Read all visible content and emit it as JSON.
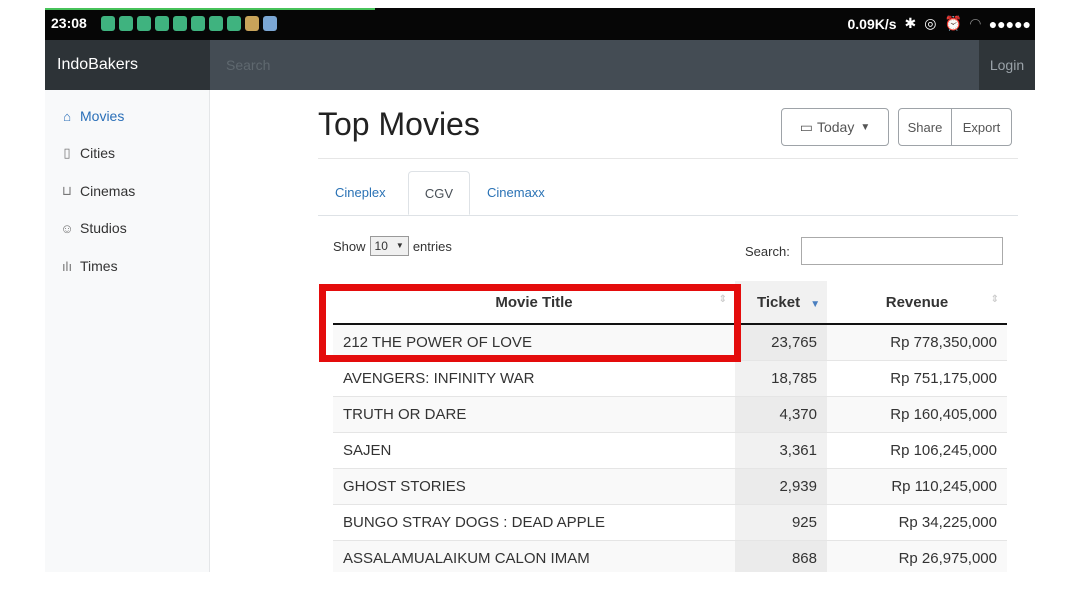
{
  "status_bar": {
    "time": "23:08",
    "net_speed": "0.09K/s",
    "icons": [
      "bluetooth-icon",
      "vpn-icon",
      "alarm-icon",
      "wifi-icon",
      "signal-icon"
    ],
    "signal_dots": "●●●●●"
  },
  "navbar": {
    "brand": "IndoBakers",
    "search_placeholder": "Search",
    "login": "Login"
  },
  "sidebar": {
    "items": [
      {
        "label": "Movies",
        "icon": "home-icon",
        "active": true
      },
      {
        "label": "Cities",
        "icon": "file-icon",
        "active": false
      },
      {
        "label": "Cinemas",
        "icon": "cart-icon",
        "active": false
      },
      {
        "label": "Studios",
        "icon": "users-icon",
        "active": false
      },
      {
        "label": "Times",
        "icon": "bar-chart-icon",
        "active": false
      }
    ]
  },
  "main": {
    "title": "Top Movies",
    "date_button": "Today",
    "share": "Share",
    "export": "Export",
    "tabs": [
      {
        "label": "Cineplex",
        "active": false
      },
      {
        "label": "CGV",
        "active": true
      },
      {
        "label": "Cinemaxx",
        "active": false
      }
    ],
    "show_label": "Show",
    "entries_value": "10",
    "entries_label": "entries",
    "search_label": "Search:"
  },
  "table": {
    "columns": [
      "Movie Title",
      "Ticket",
      "Revenue"
    ],
    "rows": [
      {
        "title": "212 THE POWER OF LOVE",
        "ticket": "23,765",
        "revenue": "Rp 778,350,000"
      },
      {
        "title": "AVENGERS: INFINITY WAR",
        "ticket": "18,785",
        "revenue": "Rp 751,175,000"
      },
      {
        "title": "TRUTH OR DARE",
        "ticket": "4,370",
        "revenue": "Rp 160,405,000"
      },
      {
        "title": "SAJEN",
        "ticket": "3,361",
        "revenue": "Rp 106,245,000"
      },
      {
        "title": "GHOST STORIES",
        "ticket": "2,939",
        "revenue": "Rp 110,245,000"
      },
      {
        "title": "BUNGO STRAY DOGS : DEAD APPLE",
        "ticket": "925",
        "revenue": "Rp 34,225,000"
      },
      {
        "title": "ASSALAMUALAIKUM CALON IMAM",
        "ticket": "868",
        "revenue": "Rp 26,975,000"
      }
    ]
  },
  "colors": {
    "highlight": "#e40c0c",
    "accent": "#2a72b5"
  }
}
